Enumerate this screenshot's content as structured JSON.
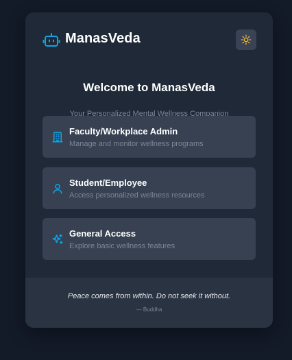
{
  "app": {
    "brand": "ManasVeda",
    "accent_color": "#0ea5e9",
    "theme_icon": "sun-icon"
  },
  "welcome": {
    "title": "Welcome to ManasVeda",
    "subtitle": "Your Personalized Mental Wellness Companion"
  },
  "options": [
    {
      "title": "Faculty/Workplace Admin",
      "description": "Manage and monitor wellness programs",
      "icon": "building-icon"
    },
    {
      "title": "Student/Employee",
      "description": "Access personalized wellness resources",
      "icon": "user-icon"
    },
    {
      "title": "General Access",
      "description": "Explore basic wellness features",
      "icon": "sparkles-icon"
    }
  ],
  "footer": {
    "quote": "Peace comes from within. Do not seek it without.",
    "author": "— Buddha"
  }
}
